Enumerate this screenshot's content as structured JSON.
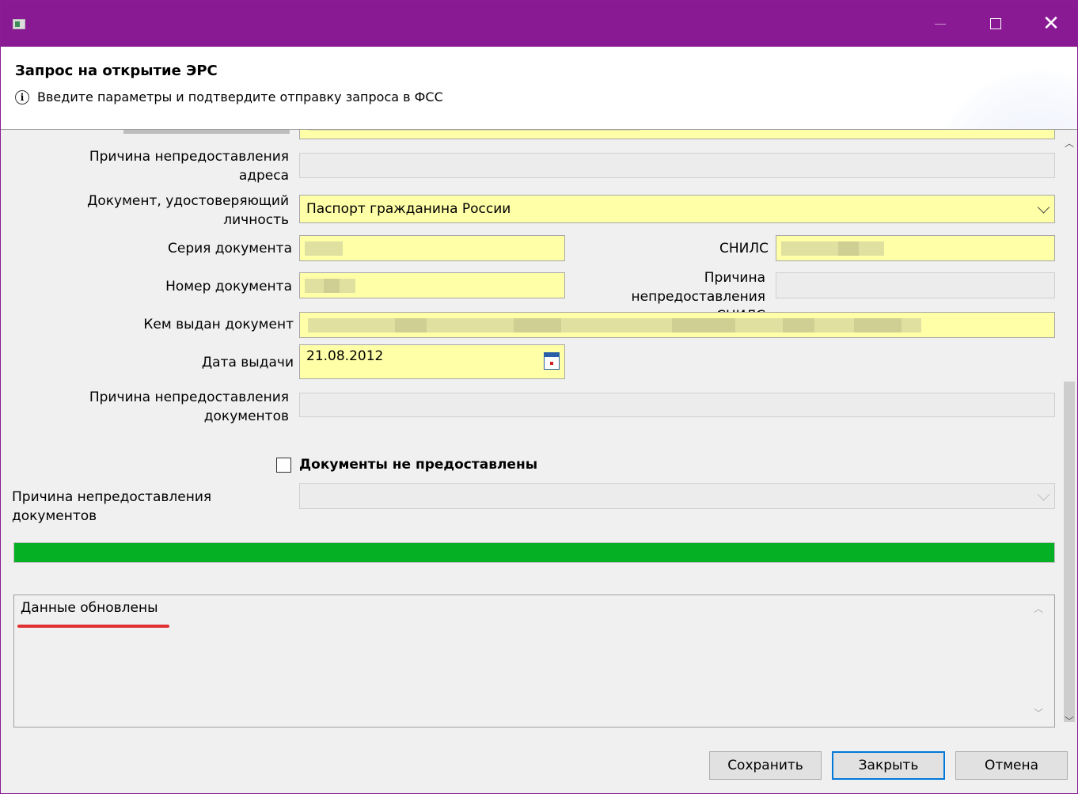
{
  "window": {
    "icon": "app-window-icon",
    "controls": {
      "minimize": "minimize",
      "maximize": "maximize",
      "close": "✕"
    }
  },
  "header": {
    "title": "Запрос на открытие ЭРС",
    "info_icon": "i",
    "info_text": "Введите параметры и подтвердите отправку запроса в ФСС"
  },
  "form": {
    "address_reason_label": "Причина непредоставления\nадреса",
    "id_doc_label": "Документ, удостоверяющий\nличность",
    "id_doc_value": "Паспорт гражданина России",
    "doc_series_label": "Серия документа",
    "snils_label": "СНИЛС",
    "doc_number_label": "Номер документа",
    "snils_reason_label": "Причина непредоставления\nСНИЛС",
    "issued_by_label": "Кем выдан документ",
    "issue_date_label": "Дата выдачи",
    "issue_date_value": "21.08.2012",
    "docs_reason_label": "Причина непредоставления\nдокументов",
    "docs_not_provided_label": "Документы не предоставлены",
    "docs_not_provided_checked": false,
    "docs_reason_select_label": "Причина непредоставления документов",
    "docs_reason_select_value": ""
  },
  "progress": {
    "percent": 100,
    "color": "#06b025"
  },
  "log": {
    "message": "Данные обновлены"
  },
  "buttons": {
    "save": "Сохранить",
    "close": "Закрыть",
    "cancel": "Отмена"
  },
  "colors": {
    "titlebar": "#8a1a94",
    "required_field": "#ffffa8",
    "underline": "#e03232"
  }
}
